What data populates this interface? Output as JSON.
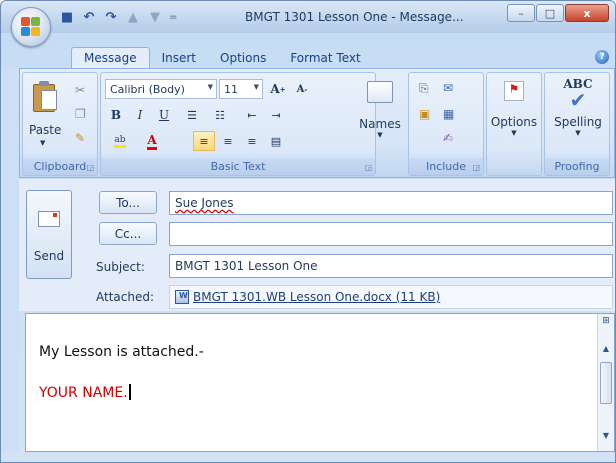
{
  "window": {
    "title": "BMGT 1301 Lesson One - Message...",
    "minimize": "–",
    "maximize": "□",
    "close": "x"
  },
  "quick_access": {
    "separator": "="
  },
  "tabs": [
    {
      "label": "Message",
      "active": true
    },
    {
      "label": "Insert",
      "active": false
    },
    {
      "label": "Options",
      "active": false
    },
    {
      "label": "Format Text",
      "active": false
    }
  ],
  "help": "?",
  "ribbon": {
    "clipboard": {
      "label": "Clipboard",
      "paste_label": "Paste"
    },
    "basic_text": {
      "label": "Basic Text",
      "font_name": "Calibri (Body)",
      "font_size": "11",
      "bold": "B",
      "italic": "I",
      "underline": "U",
      "grow_font": "A",
      "shrink_font": "A",
      "highlight": "ab",
      "font_color": "A"
    },
    "names": {
      "label": "Names"
    },
    "include": {
      "label": "Include"
    },
    "options": {
      "label": "Options"
    },
    "proofing": {
      "label": "Proofing",
      "spelling_label": "Spelling",
      "abc": "ABC"
    }
  },
  "compose": {
    "send_label": "Send",
    "to_button": "To...",
    "cc_button": "Cc...",
    "to_value": "Sue Jones",
    "cc_value": "",
    "subject_label": "Subject:",
    "subject_value": "BMGT 1301 Lesson One",
    "attached_label": "Attached:",
    "attachment": "BMGT 1301.WB Lesson One.docx (11 KB)"
  },
  "body": {
    "line1": "My Lesson is attached.-",
    "line2": "YOUR NAME."
  },
  "colors": {
    "accent": "#15428b",
    "body_red": "#d10000",
    "ribbon_bg": "#dce8f8"
  }
}
